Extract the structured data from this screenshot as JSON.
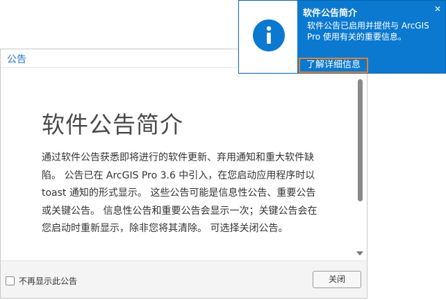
{
  "dialog": {
    "title": "公告",
    "heading": "软件公告简介",
    "body": "通过软件公告获悉即将进行的软件更新、弃用通知和重大软件缺陷。 公告已在 ArcGIS Pro 3.6 中引入，在您启动应用程序时以 toast 通知的形式显示。 这些公告可能是信息性公告、重要公告或关键公告。 信息性公告和重要公告会显示一次；关键公告会在您启动时重新显示，除非您将其清除。 可选择关闭公告。",
    "checkbox_label": "不再显示此公告",
    "close_label": "关闭"
  },
  "toast": {
    "title": "软件公告简介",
    "text": "软件公告已启用并提供与 ArcGIS Pro 使用有关的重要信息。",
    "close_glyph": "✕",
    "learn_more_label": "了解详细信息",
    "icon": "info-icon",
    "accent_color": "#0b79d0",
    "highlight_color": "#ef7d22"
  }
}
